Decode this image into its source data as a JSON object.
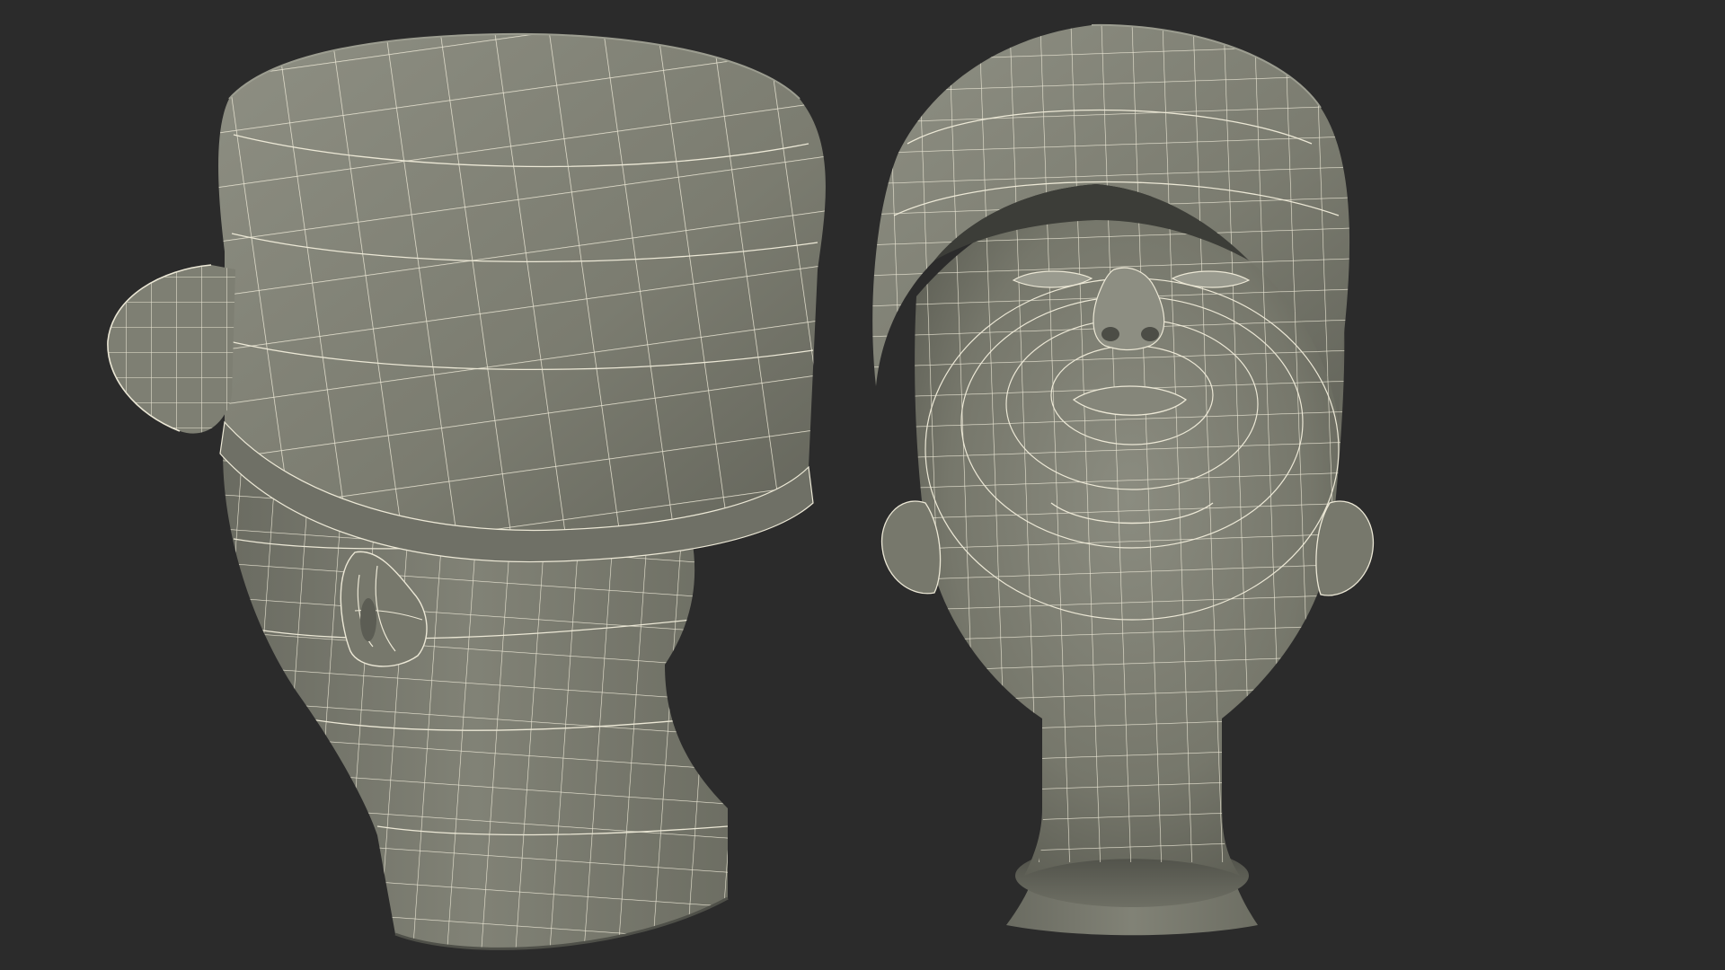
{
  "scene": {
    "background": "#2b2b2b",
    "surface": "#7b7c70",
    "surface_light": "#8d8e82",
    "surface_dark": "#5d5e54",
    "wire": "#ece8d6"
  },
  "views": [
    {
      "name": "three-quarter-back-view",
      "subject": "head-with-cap-wireframe"
    },
    {
      "name": "bottom-up-view",
      "subject": "head-with-cap-wireframe"
    }
  ]
}
